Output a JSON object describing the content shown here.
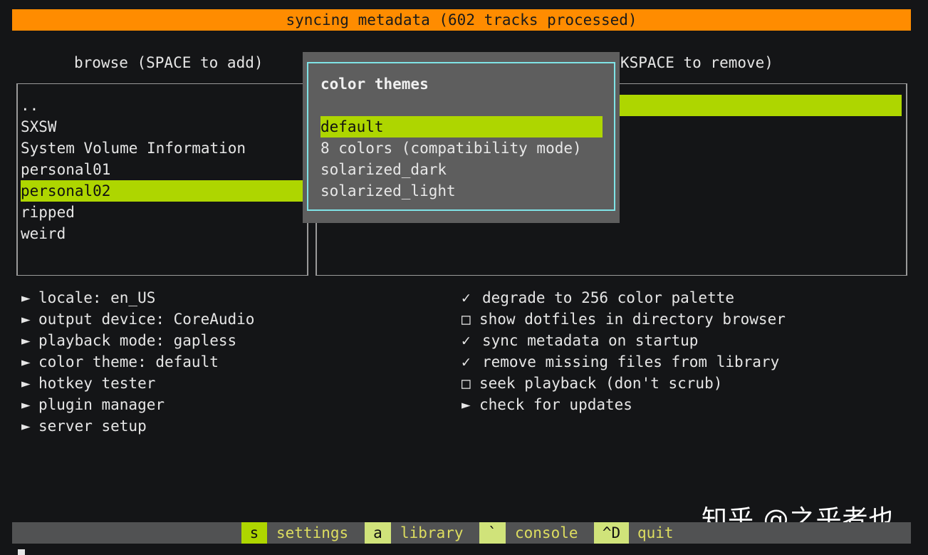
{
  "status": {
    "text": "syncing metadata (602 tracks processed)"
  },
  "browse": {
    "header": "browse (SPACE to add)",
    "items": [
      {
        "label": ".."
      },
      {
        "label": "SXSW"
      },
      {
        "label": "System Volume Information"
      },
      {
        "label": "personal01"
      },
      {
        "label": "personal02",
        "selected": true
      },
      {
        "label": "ripped"
      },
      {
        "label": "weird"
      }
    ]
  },
  "library": {
    "header_fragment": "KSPACE to remove)"
  },
  "theme_dialog": {
    "title": "color themes",
    "options": [
      {
        "label": "default",
        "selected": true
      },
      {
        "label": "8 colors (compatibility mode)"
      },
      {
        "label": "solarized_dark"
      },
      {
        "label": "solarized_light"
      }
    ]
  },
  "settings_left": [
    {
      "icon": "►",
      "label": "locale: en_US"
    },
    {
      "icon": "►",
      "label": "output device: CoreAudio"
    },
    {
      "icon": "►",
      "label": "playback mode: gapless"
    },
    {
      "icon": "►",
      "label": "color theme: default"
    },
    {
      "icon": "►",
      "label": "hotkey tester"
    },
    {
      "icon": "►",
      "label": "plugin manager"
    },
    {
      "icon": "►",
      "label": "server setup"
    }
  ],
  "settings_right": [
    {
      "icon": "✓",
      "label": "degrade to 256 color palette"
    },
    {
      "icon": "□",
      "label": "show dotfiles in directory browser"
    },
    {
      "icon": "✓",
      "label": "sync metadata on startup"
    },
    {
      "icon": "✓",
      "label": "remove missing files from library"
    },
    {
      "icon": "□",
      "label": "seek playback (don't scrub)"
    },
    {
      "icon": "►",
      "label": "check for updates"
    }
  ],
  "shortcuts": [
    {
      "key": "s",
      "label": "settings",
      "active": true
    },
    {
      "key": "a",
      "label": "library"
    },
    {
      "key": "`",
      "label": "console"
    },
    {
      "key": "^D",
      "label": "quit"
    }
  ],
  "watermark": "知乎 @之乎者也",
  "colors": {
    "accent_green": "#aed600",
    "status_orange": "#ff8c00",
    "modal_border": "#7fe3e6",
    "background": "#141517"
  }
}
